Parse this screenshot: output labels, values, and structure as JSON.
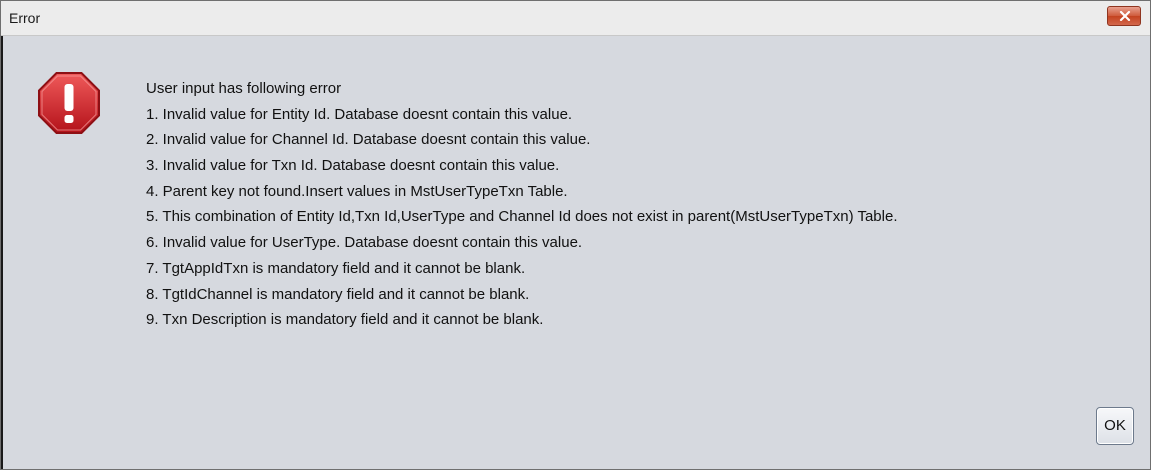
{
  "dialog": {
    "title": "Error",
    "header_line": "User input has following error",
    "errors": [
      "1. Invalid value for Entity Id. Database doesnt contain this value.",
      "2. Invalid value for Channel Id. Database doesnt contain this value.",
      "3. Invalid value for Txn Id. Database doesnt contain this value.",
      "4. Parent key not found.Insert values in MstUserTypeTxn Table.",
      "5. This combination of Entity Id,Txn Id,UserType and Channel Id does not exist in  parent(MstUserTypeTxn) Table.",
      "6. Invalid value for UserType. Database doesnt contain this value.",
      "7. TgtAppIdTxn is mandatory field and it cannot be blank.",
      "8. TgtIdChannel is mandatory field and it cannot be blank.",
      "9. Txn Description is mandatory field and it cannot be blank."
    ],
    "ok_label": "OK",
    "icon": "error-octagon-icon",
    "close_icon": "close-icon"
  },
  "colors": {
    "dialog_background": "#d6d9df",
    "titlebar_background": "#ececec",
    "error_red": "#d71f26",
    "close_button_red": "#cf5a3b"
  }
}
